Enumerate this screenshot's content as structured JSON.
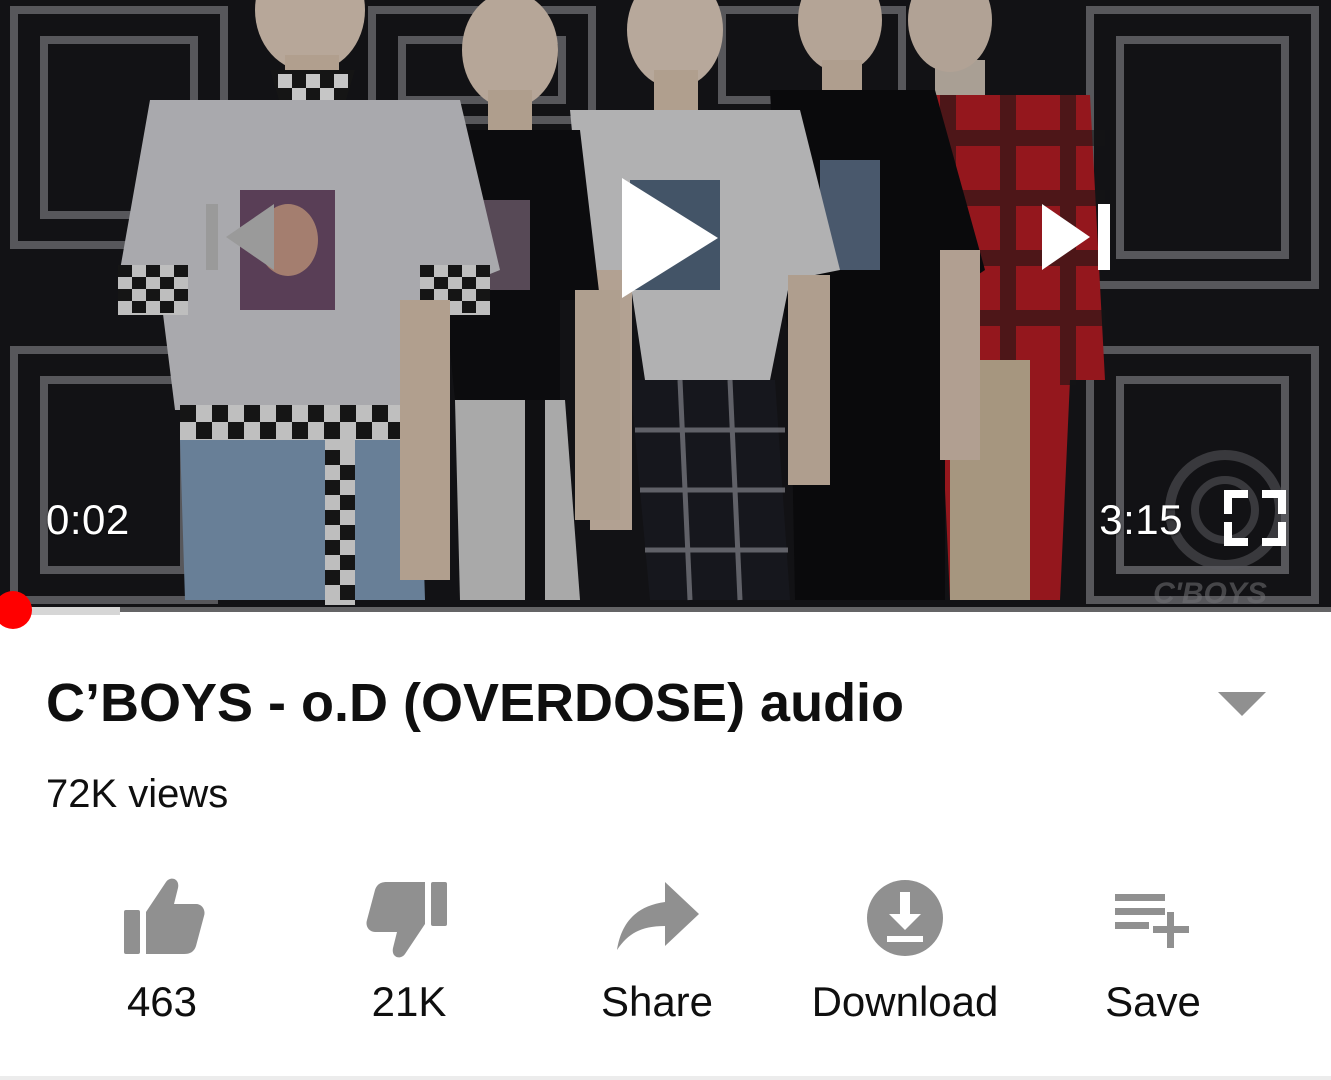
{
  "video": {
    "current_time": "0:02",
    "duration": "3:15",
    "progress_fraction": 0.01,
    "buffered_fraction": 0.09,
    "watermark": "C'BOYS"
  },
  "info": {
    "title": "C’BOYS - o.D (OVERDOSE) audio",
    "views": "72K views"
  },
  "actions": {
    "like": {
      "label": "463",
      "icon": "thumbs-up-icon"
    },
    "dislike": {
      "label": "21K",
      "icon": "thumbs-down-icon"
    },
    "share": {
      "label": "Share",
      "icon": "share-arrow-icon"
    },
    "download": {
      "label": "Download",
      "icon": "download-icon"
    },
    "save": {
      "label": "Save",
      "icon": "playlist-add-icon"
    }
  },
  "colors": {
    "accent": "#ff0000",
    "icon_gray": "#909090",
    "text": "#0f0f0f"
  }
}
